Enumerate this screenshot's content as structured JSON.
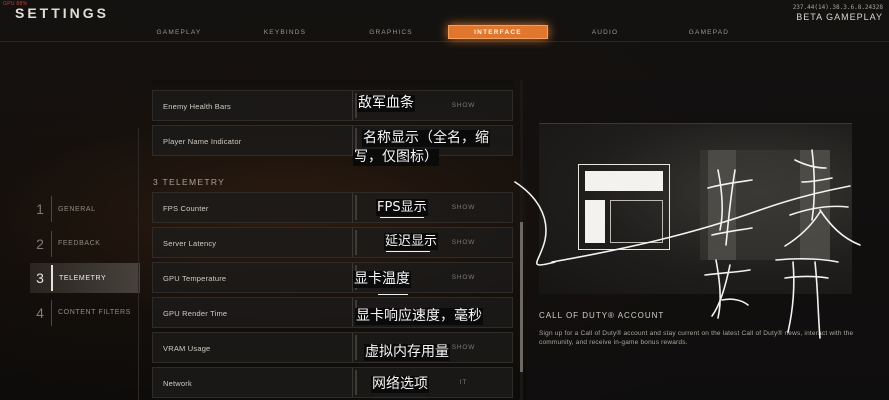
{
  "top_bar": {
    "gpu_tag": "GPU 88%",
    "title": "SETTINGS",
    "build_id": "237.44(14).38.3.6.8.24328",
    "build_label": "BETA GAMEPLAY"
  },
  "tabs": [
    {
      "label": "GAMEPLAY",
      "active": false
    },
    {
      "label": "KEYBINDS",
      "active": false
    },
    {
      "label": "GRAPHICS",
      "active": false
    },
    {
      "label": "INTERFACE",
      "active": true
    },
    {
      "label": "AUDIO",
      "active": false
    },
    {
      "label": "GAMEPAD",
      "active": false
    }
  ],
  "left_nav": [
    {
      "number": "1",
      "label": "GENERAL",
      "active": false
    },
    {
      "number": "2",
      "label": "FEEDBACK",
      "active": false
    },
    {
      "number": "3",
      "label": "TELEMETRY",
      "active": true
    },
    {
      "number": "4",
      "label": "CONTENT FILTERS",
      "active": false
    }
  ],
  "settings": {
    "top_rows": [
      {
        "label": "Enemy Health Bars",
        "value": "SHOW"
      },
      {
        "label": "Player Name Indicator",
        "value": ""
      }
    ],
    "section_heading": "3 TELEMETRY",
    "telemetry_rows": [
      {
        "label": "FPS Counter",
        "value": "SHOW"
      },
      {
        "label": "Server Latency",
        "value": "SHOW"
      },
      {
        "label": "GPU Temperature",
        "value": "SHOW"
      },
      {
        "label": "GPU Render Time",
        "value": ""
      },
      {
        "label": "VRAM Usage",
        "value": "SHOW"
      },
      {
        "label": "Network",
        "value": "IT"
      }
    ]
  },
  "account": {
    "title": "CALL OF DUTY® ACCOUNT",
    "description": "Sign up for a Call of Duty® account and stay current on the latest Call of Duty® news, interact with the community, and receive in-game bonus rewards."
  },
  "annotations": {
    "enemy_health": "敌军血条",
    "name_indicator_1": "名称显示（全名，缩",
    "name_indicator_2": "写，仅图标）",
    "fps": "FPS显示",
    "latency": "延迟显示",
    "gpu_temp": "显卡温度",
    "render_time": "显卡响应速度，毫秒",
    "vram": "虚拟内存用量",
    "network": "网络选项"
  },
  "colors": {
    "accent": "#e0772c",
    "background": "#0d0c0b",
    "text": "#c9c6bf"
  }
}
